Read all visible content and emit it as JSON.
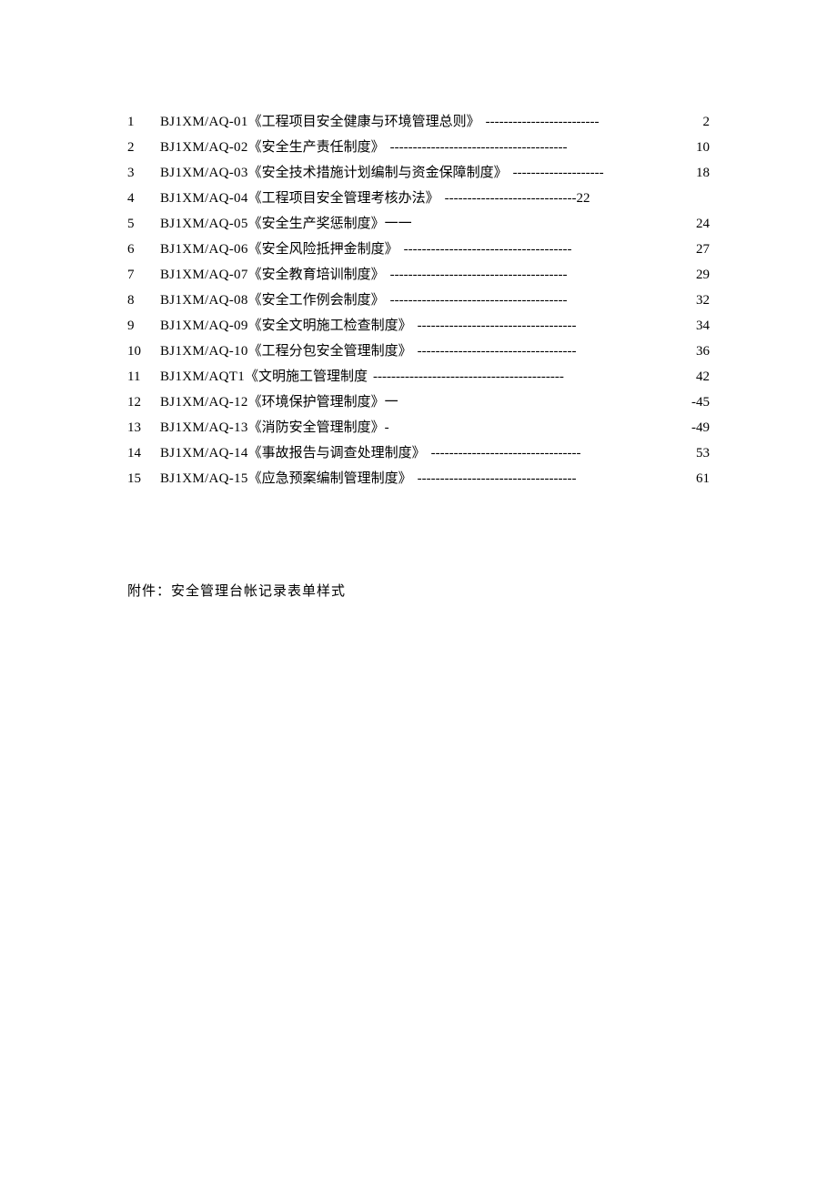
{
  "toc": {
    "items": [
      {
        "num": "1",
        "code": "BJ1XM/AQ-01",
        "title": "《工程项目安全健康与环境管理总则》",
        "leader": "-------------------------",
        "page": "2"
      },
      {
        "num": "2",
        "code": "BJ1XM/AQ-02",
        "title": "《安全生产责任制度》",
        "leader": "---------------------------------------",
        "page": "10"
      },
      {
        "num": "3",
        "code": "BJ1XM/AQ-03",
        "title": "《安全技术措施计划编制与资金保障制度》",
        "leader": "--------------------",
        "page": "18"
      },
      {
        "num": "4",
        "code": "BJ1XM/AQ-04",
        "title": "《工程项目安全管理考核办法》",
        "leader": "-----------------------------22",
        "page": ""
      },
      {
        "num": "5",
        "code": "BJ1XM/AQ-05",
        "title": "《安全生产奖惩制度》一一",
        "leader": "",
        "page": "24"
      },
      {
        "num": "6",
        "code": "BJ1XM/AQ-06",
        "title": "《安全风险抵押金制度》",
        "leader": "-------------------------------------",
        "page": "27"
      },
      {
        "num": "7",
        "code": "BJ1XM/AQ-07",
        "title": "《安全教育培训制度》",
        "leader": "---------------------------------------",
        "page": "29"
      },
      {
        "num": "8",
        "code": "BJ1XM/AQ-08",
        "title": "《安全工作例会制度》",
        "leader": "---------------------------------------",
        "page": "32"
      },
      {
        "num": "9",
        "code": "BJ1XM/AQ-09",
        "title": "《安全文明施工检查制度》",
        "leader": "-----------------------------------",
        "page": "34"
      },
      {
        "num": "10",
        "code": "BJ1XM/AQ-10",
        "title": "《工程分包安全管理制度》",
        "leader": "-----------------------------------",
        "page": "36"
      },
      {
        "num": "11",
        "code": "BJ1XM/AQT1",
        "title": "《文明施工管理制度",
        "leader": "------------------------------------------",
        "page": "42"
      },
      {
        "num": "12",
        "code": "BJ1XM/AQ-12",
        "title": "《环境保护管理制度》一",
        "leader": "",
        "page": "-45"
      },
      {
        "num": "13",
        "code": "BJ1XM/AQ-13",
        "title": "《消防安全管理制度》-",
        "leader": "",
        "page": "-49"
      },
      {
        "num": "14",
        "code": "BJ1XM/AQ-14",
        "title": "《事故报告与调查处理制度》",
        "leader": "---------------------------------",
        "page": "53"
      },
      {
        "num": "15",
        "code": "BJ1XM/AQ-15",
        "title": "《应急预案编制管理制度》",
        "leader": "-----------------------------------",
        "page": "61"
      }
    ]
  },
  "appendix": {
    "text": "附件：安全管理台帐记录表单样式"
  }
}
